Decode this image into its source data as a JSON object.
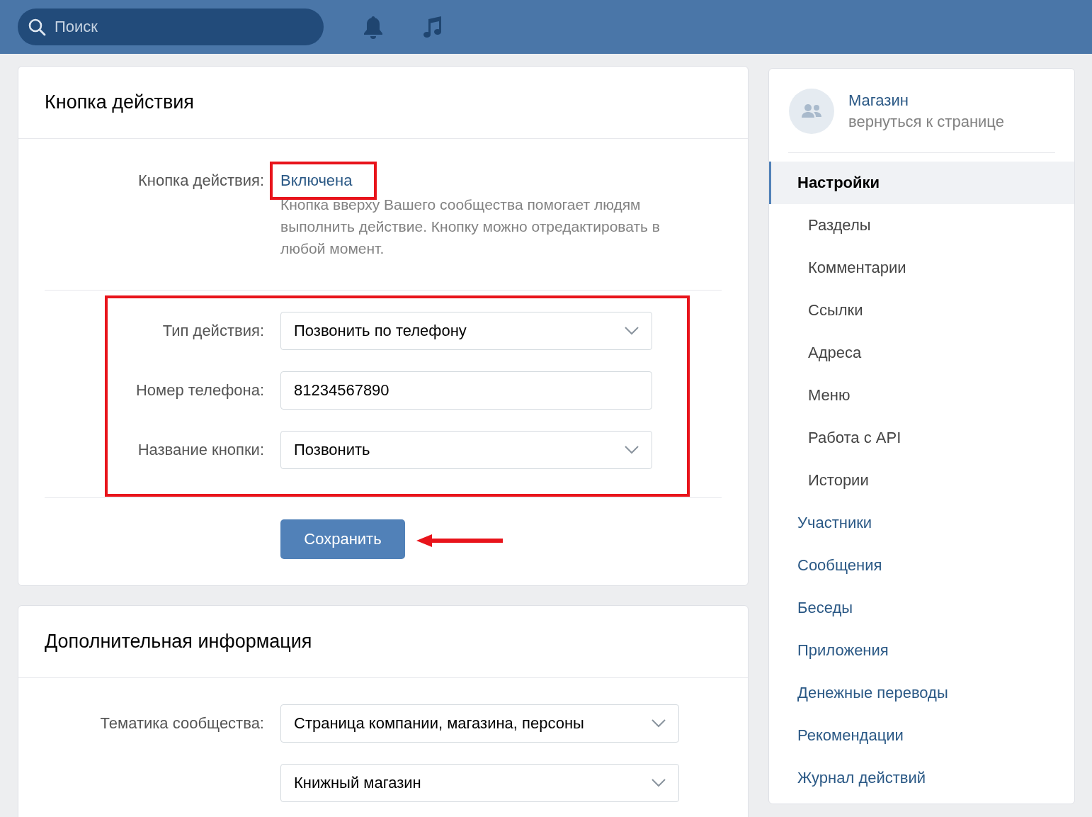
{
  "topbar": {
    "search": {
      "placeholder": "Поиск"
    }
  },
  "action_card": {
    "title": "Кнопка действия",
    "status": {
      "label": "Кнопка действия:",
      "value": "Включена",
      "highlighted": true
    },
    "description": "Кнопка вверху Вашего сообщества помогает людям выполнить действие. Кнопку можно отредактировать в любой момент.",
    "fields_highlighted": true,
    "fields": [
      {
        "label": "Тип действия:",
        "kind": "select",
        "value": "Позвонить по телефону"
      },
      {
        "label": "Номер телефона:",
        "kind": "input",
        "value": "81234567890"
      },
      {
        "label": "Название кнопки:",
        "kind": "select",
        "value": "Позвонить"
      }
    ],
    "save_button": {
      "label": "Сохранить",
      "pointed": true
    }
  },
  "info_card": {
    "title": "Дополнительная информация",
    "fields": [
      {
        "label": "Тематика сообщества:",
        "kind": "select",
        "value": "Страница компании, магазина, персоны"
      },
      {
        "kind": "select",
        "value": "Книжный магазин"
      }
    ]
  },
  "sidebar": {
    "community": {
      "name": "Магазин",
      "link": "вернуться к странице"
    },
    "items": [
      {
        "label": "Настройки",
        "selected": true,
        "children": [
          {
            "label": "Разделы",
            "selected": false
          },
          {
            "label": "Комментарии",
            "selected": false
          },
          {
            "label": "Ссылки",
            "selected": false
          },
          {
            "label": "Адреса",
            "selected": false
          },
          {
            "label": "Меню",
            "selected": false
          },
          {
            "label": "Работа с API",
            "selected": false
          },
          {
            "label": "Истории",
            "selected": false
          }
        ]
      },
      {
        "label": "Участники",
        "selected": false
      },
      {
        "label": "Сообщения",
        "selected": false
      },
      {
        "label": "Беседы",
        "selected": false
      },
      {
        "label": "Приложения",
        "selected": false
      },
      {
        "label": "Денежные переводы",
        "selected": false
      },
      {
        "label": "Рекомендации",
        "selected": false
      },
      {
        "label": "Журнал действий",
        "selected": false
      }
    ]
  }
}
